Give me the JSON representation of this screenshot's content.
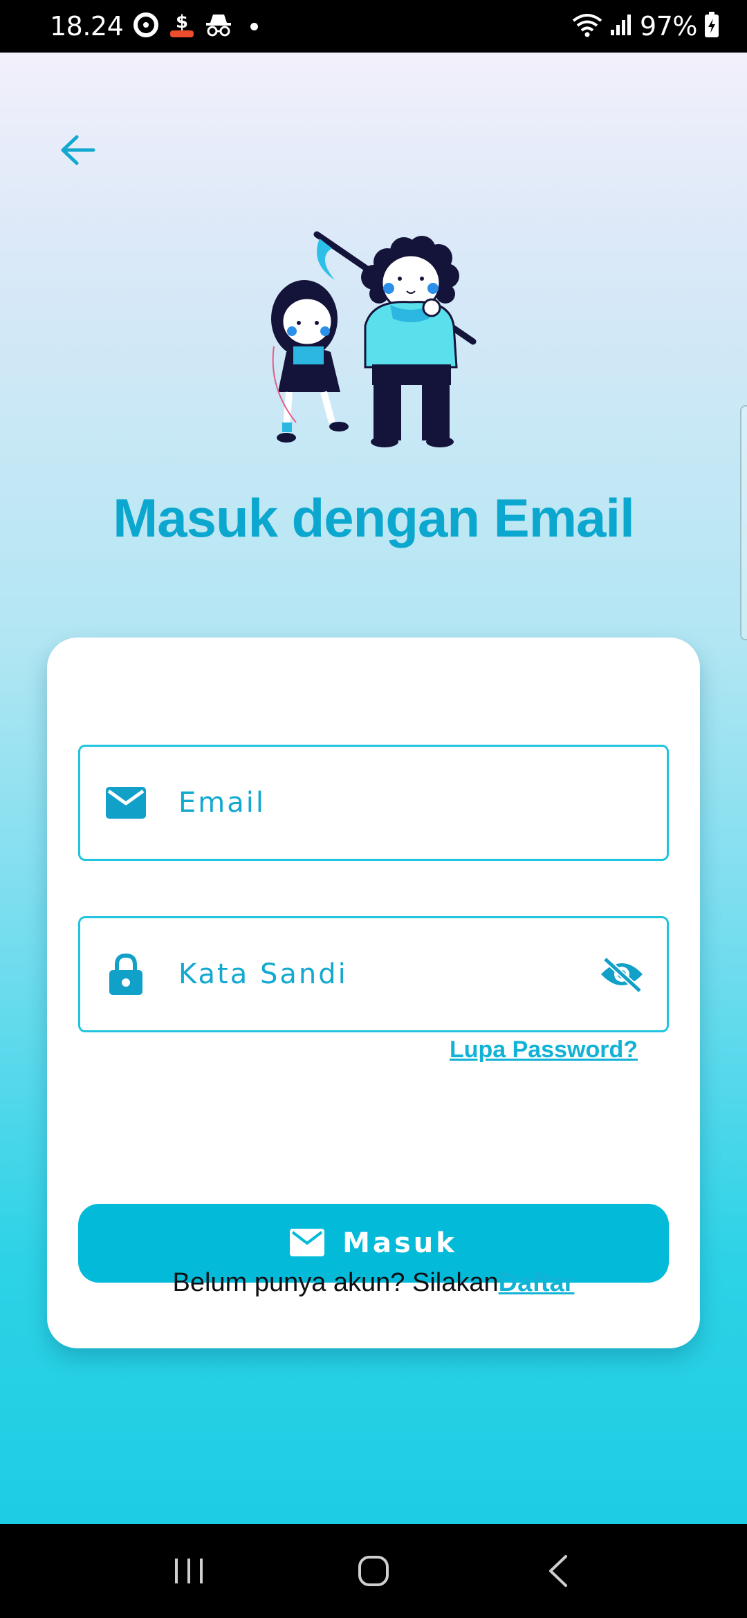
{
  "status_bar": {
    "time": "18.24",
    "battery": "97%",
    "icons": [
      "location-ring-icon",
      "shopee-icon",
      "incognito-icon",
      "wifi-icon",
      "signal-icon",
      "battery-charging-icon"
    ]
  },
  "header": {
    "back_icon": "arrow-left-icon",
    "title": "Masuk dengan Email"
  },
  "form": {
    "email": {
      "placeholder": "Email",
      "value": "",
      "icon": "mail-icon"
    },
    "password": {
      "placeholder": "Kata Sandi",
      "value": "",
      "icon": "lock-icon",
      "toggle_icon": "eye-off-icon"
    },
    "forgot_label": "Lupa Password?",
    "submit_label": "Masuk",
    "submit_icon": "mail-icon",
    "register_prompt": "Belum punya akun? Silakan",
    "register_label": "Daftar"
  },
  "nav_bar": {
    "items": [
      "recents-icon",
      "home-icon",
      "back-icon"
    ]
  },
  "colors": {
    "accent": "#0ca7cf",
    "button": "#03bbd9",
    "field_border": "#1fc4de",
    "link": "#12b2d6"
  }
}
